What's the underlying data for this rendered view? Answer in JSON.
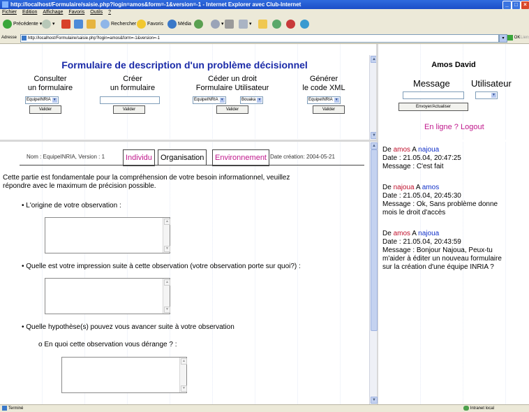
{
  "window": {
    "title": "http://localhost/Formulaire/saisie.php?login=amos&form=-1&version=-1 - Internet Explorer avec Club-Internet"
  },
  "menu": [
    "Fichier",
    "Edition",
    "Affichage",
    "Favoris",
    "Outils",
    "?"
  ],
  "toolbar": {
    "back": "Précédente",
    "search": "Rechercher",
    "favorites": "Favoris",
    "media": "Média"
  },
  "address": {
    "label": "Adresse",
    "url": "http://localhost/Formulaire/saisie.php?login=amos&form=-1&version=-1",
    "go": "OK",
    "links": "Liens"
  },
  "top": {
    "title": "Formulaire de description d'un problème décisionnel",
    "col1": {
      "line1": "Consulter",
      "line2": "un formulaire",
      "select": "EquipeINRIA",
      "button": "Valider"
    },
    "col2": {
      "line1": "Créer",
      "line2": "un formulaire",
      "button": "Valider"
    },
    "col3": {
      "line1": "Céder un droit",
      "line2": "Formulaire Utilisateur",
      "select1": "EquipeINRIA",
      "select2": "Bouaka",
      "button": "Valider"
    },
    "col4": {
      "line1": "Générer",
      "line2": "le code XML",
      "select": "EquipeINRIA",
      "button": "Valider"
    }
  },
  "user_panel": {
    "name": "Amos David",
    "message_label": "Message",
    "user_label": "Utilisateur",
    "send_button": "Envoyer/Actualiser",
    "online": "En ligne ?",
    "logout": "Logout"
  },
  "form": {
    "meta": "Nom : EquipeINRIA, Version : 1",
    "tabs": [
      "Individu",
      "Organisation",
      "Environnement"
    ],
    "created": "Date création: 2004-05-21",
    "intro_line1": "Cette partie est fondamentale pour la compréhension de votre besoin informationnel, veuillez",
    "intro_line2": "répondre avec le maximum de précision possible.",
    "q1": "L'origine de votre observation :",
    "q2": "Quelle est votre impression suite à cette observation (votre observation porte sur quoi?) :",
    "q3": "Quelle hypothèse(s) pouvez vous avancer suite à votre observation",
    "q3a": "En quoi cette observation vous dérange ? :"
  },
  "messages": [
    {
      "de": "De",
      "from": "amos",
      "a": "A",
      "to": "najoua",
      "date": "Date : 21.05.04, 20:47:25",
      "text1": "Message : C'est fait",
      "text2": "",
      "text3": ""
    },
    {
      "de": "De",
      "from": "najoua",
      "a": "A",
      "to": "amos",
      "date": "Date : 21.05.04, 20:45:30",
      "text1": "Message : Ok, Sans problème donne",
      "text2": "mois le droit d'accès",
      "text3": ""
    },
    {
      "de": "De",
      "from": "amos",
      "a": "A",
      "to": "najoua",
      "date": "Date : 21.05.04, 20:43:59",
      "text1": "Message : Bonjour Najoua, Peux-tu",
      "text2": "m'aider à éditer un nouveau formulaire",
      "text3": "sur la création d'une équipe INRIA ?"
    }
  ],
  "status": {
    "left": "Terminé",
    "right": "Intranet local"
  },
  "colors": {
    "title_blue": "#1a2aa8",
    "pink": "#c0188c",
    "red": "#c0102c",
    "msg_blue": "#1030c8"
  }
}
